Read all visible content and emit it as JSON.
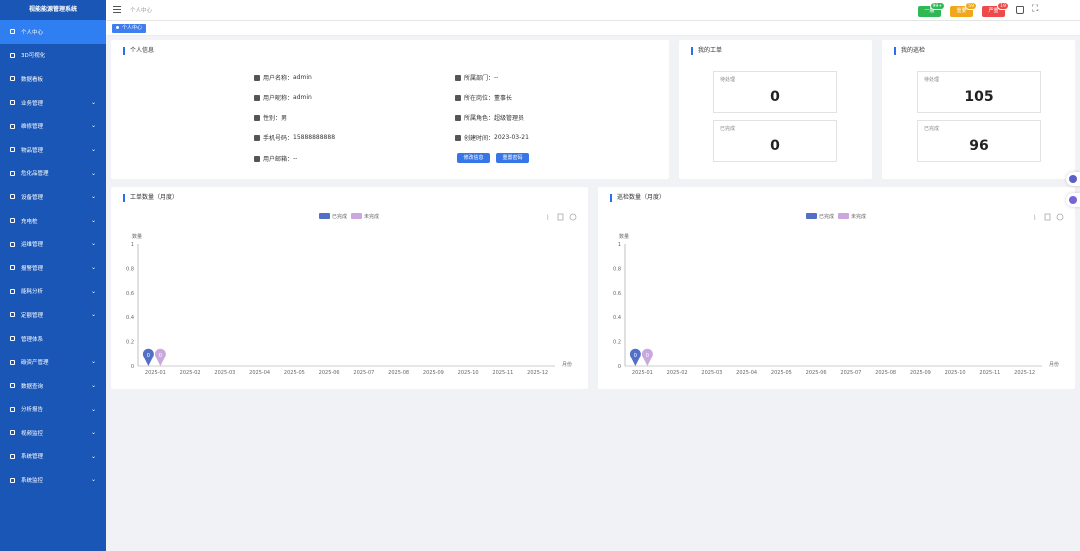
{
  "app": {
    "title": "视能能源管理系统"
  },
  "sidebar": {
    "items": [
      {
        "label": "个人中心",
        "icon": "home-icon",
        "has_children": false
      },
      {
        "label": "3D可视化",
        "icon": "cube-icon",
        "has_children": false
      },
      {
        "label": "数据看板",
        "icon": "dashboard-icon",
        "has_children": false
      },
      {
        "label": "业务管理",
        "icon": "briefcase-icon",
        "has_children": true
      },
      {
        "label": "维修管理",
        "icon": "wrench-icon",
        "has_children": true
      },
      {
        "label": "物品管理",
        "icon": "box-icon",
        "has_children": true
      },
      {
        "label": "危化品管理",
        "icon": "flask-icon",
        "has_children": true
      },
      {
        "label": "设备管理",
        "icon": "chart-icon",
        "has_children": true
      },
      {
        "label": "充电桩",
        "icon": "plug-icon",
        "has_children": true
      },
      {
        "label": "运维管理",
        "icon": "tools-icon",
        "has_children": true
      },
      {
        "label": "报警管理",
        "icon": "bell-icon",
        "has_children": true
      },
      {
        "label": "能耗分析",
        "icon": "analysis-icon",
        "has_children": true
      },
      {
        "label": "定额管理",
        "icon": "quota-icon",
        "has_children": true
      },
      {
        "label": "管理体系",
        "icon": "system-icon",
        "has_children": false
      },
      {
        "label": "碳资产管理",
        "icon": "leaf-icon",
        "has_children": true
      },
      {
        "label": "数据查询",
        "icon": "query-icon",
        "has_children": true
      },
      {
        "label": "分析报告",
        "icon": "report-icon",
        "has_children": true
      },
      {
        "label": "视频监控",
        "icon": "camera-icon",
        "has_children": true
      },
      {
        "label": "系统管理",
        "icon": "gear-icon",
        "has_children": true
      },
      {
        "label": "系统监控",
        "icon": "monitor-icon",
        "has_children": true
      }
    ]
  },
  "topbar": {
    "breadcrumb": "个人中心",
    "badges": [
      {
        "label": "一般",
        "count": "99+",
        "color": "#2fb954"
      },
      {
        "label": "重要",
        "count": "59",
        "color": "#f0a71a"
      },
      {
        "label": "严重",
        "count": "19",
        "color": "#ee4a4a"
      }
    ]
  },
  "tags": [
    {
      "label": "个人中心"
    }
  ],
  "profile": {
    "title": "个人信息",
    "fields_left": [
      {
        "label": "用户名称：",
        "value": "admin",
        "icon": "user-icon"
      },
      {
        "label": "用户昵称：",
        "value": "admin",
        "icon": "user-tag-icon"
      },
      {
        "label": "性别：",
        "value": "男",
        "icon": "gender-icon"
      },
      {
        "label": "手机号码：",
        "value": "15888888888",
        "icon": "phone-icon"
      },
      {
        "label": "用户邮箱：",
        "value": "--",
        "icon": "mail-icon"
      }
    ],
    "fields_right": [
      {
        "label": "所属部门：",
        "value": "--",
        "icon": "org-icon"
      },
      {
        "label": "所在岗位：",
        "value": "董事长",
        "icon": "badge-icon"
      },
      {
        "label": "所属角色：",
        "value": "超级管理员",
        "icon": "role-icon"
      },
      {
        "label": "创建时间：",
        "value": "2023-03-21",
        "icon": "calendar-icon"
      }
    ],
    "edit_button": "修改信息",
    "reset_button": "重置密码"
  },
  "work_orders": {
    "title": "我的工单",
    "pending_label": "待处理",
    "pending_value": "0",
    "done_label": "已完成",
    "done_value": "0"
  },
  "inspections": {
    "title": "我的巡检",
    "pending_label": "待处理",
    "pending_value": "105",
    "done_label": "已完成",
    "done_value": "96"
  },
  "colors": {
    "done": "#5470c6",
    "undone": "#c9a8de",
    "accent": "#2d6fe8"
  },
  "chart_data": [
    {
      "type": "line",
      "title": "工单数量（月度）",
      "ylabel": "数量",
      "xlabel": "月份",
      "x": [
        "2025-01",
        "2025-02",
        "2025-03",
        "2025-04",
        "2025-05",
        "2025-06",
        "2025-07",
        "2025-08",
        "2025-09",
        "2025-10",
        "2025-11",
        "2025-12"
      ],
      "yticks": [
        "0",
        "0.2",
        "0.4",
        "0.6",
        "0.8",
        "1"
      ],
      "ylim": [
        0,
        1
      ],
      "legend_position": "top",
      "series": [
        {
          "name": "已完成",
          "values": [
            0
          ],
          "marker_label": "0"
        },
        {
          "name": "未完成",
          "values": [
            0
          ],
          "marker_label": "0"
        }
      ]
    },
    {
      "type": "line",
      "title": "巡检数量（月度）",
      "ylabel": "数量",
      "xlabel": "月份",
      "x": [
        "2025-01",
        "2025-02",
        "2025-03",
        "2025-04",
        "2025-05",
        "2025-06",
        "2025-07",
        "2025-08",
        "2025-09",
        "2025-10",
        "2025-11",
        "2025-12"
      ],
      "yticks": [
        "0",
        "0.2",
        "0.4",
        "0.6",
        "0.8",
        "1"
      ],
      "ylim": [
        0,
        1
      ],
      "legend_position": "top",
      "series": [
        {
          "name": "已完成",
          "values": [
            0
          ],
          "marker_label": "0"
        },
        {
          "name": "未完成",
          "values": [
            0
          ],
          "marker_label": "0"
        }
      ]
    }
  ]
}
